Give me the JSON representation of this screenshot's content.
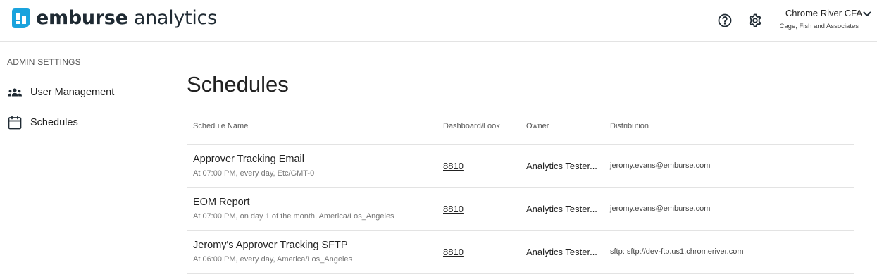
{
  "app": {
    "brand_bold": "emburse",
    "brand_light": " analytics",
    "accent_color": "#1aa3dd"
  },
  "header": {
    "icons": [
      "help-circle-icon",
      "gear-icon"
    ],
    "account_name": "Chrome River CFA",
    "account_org": "Cage, Fish and Associates"
  },
  "sidebar": {
    "heading": "ADMIN SETTINGS",
    "items": [
      {
        "label": "User Management",
        "icon": "users-icon"
      },
      {
        "label": "Schedules",
        "icon": "calendar-icon"
      }
    ]
  },
  "main": {
    "title": "Schedules",
    "columns": [
      "Schedule Name",
      "Dashboard/Look",
      "Owner",
      "Distribution"
    ],
    "rows": [
      {
        "name": "Approver Tracking Email",
        "frequency": "At 07:00 PM, every day, Etc/GMT-0",
        "look": "8810",
        "owner": "Analytics Tester...",
        "distribution": "jeromy.evans@emburse.com"
      },
      {
        "name": "EOM Report",
        "frequency": "At 07:00 PM, on day 1 of the month, America/Los_Angeles",
        "look": "8810",
        "owner": "Analytics Tester...",
        "distribution": "jeromy.evans@emburse.com"
      },
      {
        "name": "Jeromy's Approver Tracking SFTP",
        "frequency": "At 06:00 PM, every day, America/Los_Angeles",
        "look": "8810",
        "owner": "Analytics Tester...",
        "distribution": "sftp: sftp://dev-ftp.us1.chromeriver.com"
      }
    ]
  }
}
